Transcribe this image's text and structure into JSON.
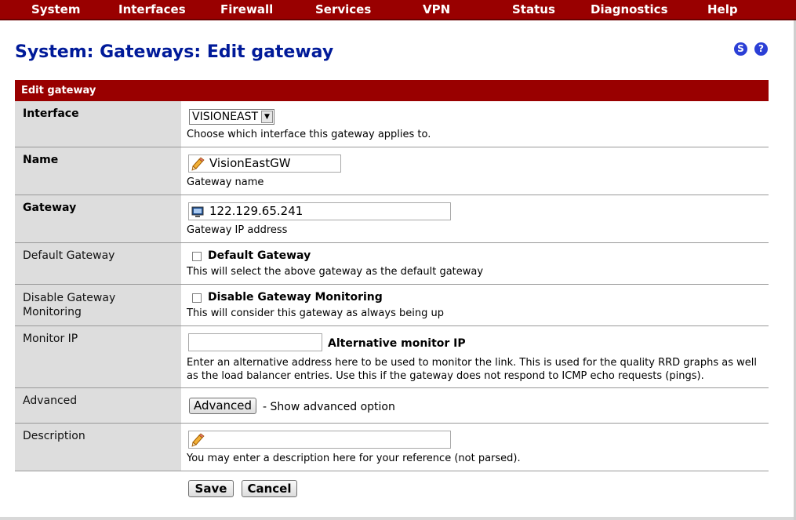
{
  "nav": {
    "items": [
      {
        "label": "System"
      },
      {
        "label": "Interfaces"
      },
      {
        "label": "Firewall"
      },
      {
        "label": "Services"
      },
      {
        "label": "VPN"
      },
      {
        "label": "Status"
      },
      {
        "label": "Diagnostics"
      },
      {
        "label": "Help"
      }
    ]
  },
  "page": {
    "title": "System: Gateways: Edit gateway",
    "status_icon": "S",
    "help_icon": "?"
  },
  "form": {
    "header": "Edit gateway",
    "interface": {
      "label": "Interface",
      "value": "VISIONEAST",
      "note": "Choose which interface this gateway applies to."
    },
    "name": {
      "label": "Name",
      "value": "VisionEastGW",
      "note": "Gateway name"
    },
    "gateway": {
      "label": "Gateway",
      "value": "122.129.65.241",
      "note": "Gateway IP address"
    },
    "default_gateway": {
      "label": "Default Gateway",
      "checkbox_label": "Default Gateway",
      "checked": false,
      "note": "This will select the above gateway as the default gateway"
    },
    "disable_monitoring": {
      "label_line1": "Disable Gateway",
      "label_line2": "Monitoring",
      "checkbox_label": "Disable Gateway Monitoring",
      "checked": false,
      "note": "This will consider this gateway as always being up"
    },
    "monitor_ip": {
      "label": "Monitor IP",
      "value": "",
      "inline_label": "Alternative monitor IP",
      "note_line1": "Enter an alternative address here to be used to monitor the link. This is used for the quality RRD graphs as well",
      "note_line2": "as the load balancer entries. Use this if the gateway does not respond to ICMP echo requests (pings)."
    },
    "advanced": {
      "label": "Advanced",
      "button": "Advanced",
      "note": "- Show advanced option"
    },
    "description": {
      "label": "Description",
      "value": "",
      "note": "You may enter a description here for your reference (not parsed)."
    },
    "save_button": "Save",
    "cancel_button": "Cancel"
  },
  "icons": {
    "pencil": "pencil-icon",
    "network": "network-icon",
    "status": "status-icon",
    "help": "help-icon",
    "dropdown": "chevron-down-icon"
  },
  "colors": {
    "nav_bg": "#990000",
    "title": "#001a99",
    "label_bg": "#dddddd",
    "icon_blue": "#2b3fd6"
  }
}
